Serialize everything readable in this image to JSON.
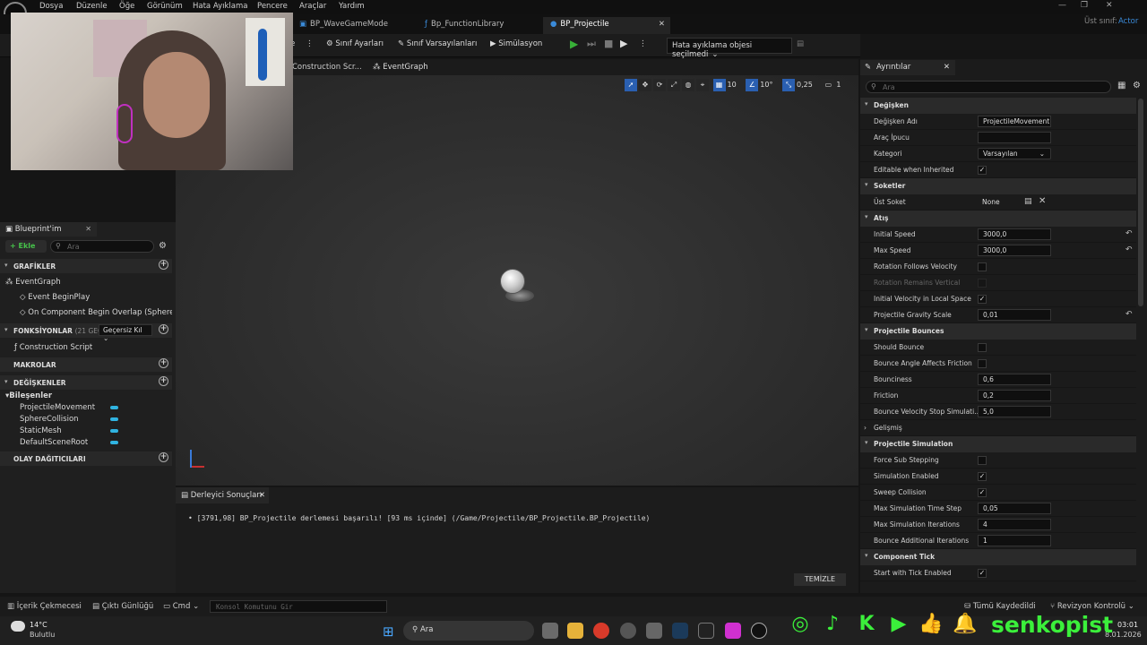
{
  "menu": [
    "Dosya",
    "Düzenle",
    "Öğe",
    "Görünüm",
    "Hata Ayıklama",
    "Pencere",
    "Araçlar",
    "Yardım"
  ],
  "tabs": [
    {
      "label": "BP_WaveGameMode"
    },
    {
      "label": "Bp_FunctionLibrary"
    },
    {
      "label": "BP_Projectile"
    }
  ],
  "window": {
    "parent_class_label": "Üst sınıf:",
    "parent_class": "Actor"
  },
  "toolbar": {
    "class_settings": "Sınıf Ayarları",
    "class_defaults": "Sınıf Varsayılanları",
    "simulation": "Simülasyon",
    "debug_object": "Hata ayıklama objesi seçilmedi"
  },
  "graph_tabs": {
    "construction": "Construction Scr...",
    "eventgraph": "EventGraph"
  },
  "viewport": {
    "grid": "10",
    "angle": "10°",
    "scale": "0,25",
    "camera": "1"
  },
  "blueprint_panel": {
    "tab": "Blueprint'im",
    "add": "Ekle",
    "search_placeholder": "Ara",
    "graphs_header": "GRAFİKLER",
    "eventgraph": "EventGraph",
    "event_beginplay": "Event BeginPlay",
    "event_overlap": "On Component Begin Overlap (SphereCol",
    "functions_header": "FONKSİYONLAR",
    "functions_count": "(21 GEÇERSİ",
    "override": "Geçersiz Kıl",
    "construction_script": "Construction Script",
    "macros_header": "MAKROLAR",
    "variables_header": "DEĞİŞKENLER",
    "components_header": "Bileşenler",
    "components": [
      "ProjectileMovement",
      "SphereCollision",
      "StaticMesh",
      "DefaultSceneRoot"
    ],
    "dispatchers_header": "OLAY DAĞITICILARI"
  },
  "compiler": {
    "tab": "Derleyici Sonuçları",
    "message": "[3791,98] BP_Projectile derlemesi başarılı! [93 ms içinde] (/Game/Projectile/BP_Projectile.BP_Projectile)",
    "clear": "TEMİZLE"
  },
  "details": {
    "tab": "Ayrıntılar",
    "search_placeholder": "Ara",
    "sec_variable": "Değişken",
    "var_name_label": "Değişken Adı",
    "var_name": "ProjectileMovement",
    "tooltip_label": "Araç İpucu",
    "tooltip": "",
    "category_label": "Kategori",
    "category": "Varsayılan",
    "editable_label": "Editable when Inherited",
    "sec_sockets": "Soketler",
    "parent_socket_label": "Üst Soket",
    "parent_socket": "None",
    "sec_shot": "Atış",
    "initial_speed_label": "Initial Speed",
    "initial_speed": "3000,0",
    "max_speed_label": "Max Speed",
    "max_speed": "3000,0",
    "rot_follows_label": "Rotation Follows Velocity",
    "rot_remains_label": "Rotation Remains Vertical",
    "init_vel_label": "Initial Velocity in Local Space",
    "gravity_label": "Projectile Gravity Scale",
    "gravity": "0,01",
    "sec_bounces": "Projectile Bounces",
    "should_bounce_label": "Should Bounce",
    "bounce_angle_label": "Bounce Angle Affects Friction",
    "bounciness_label": "Bounciness",
    "bounciness": "0,6",
    "friction_label": "Friction",
    "friction": "0,2",
    "bounce_stop_label": "Bounce Velocity Stop Simulati...",
    "bounce_stop": "5,0",
    "advanced": "Gelişmiş",
    "sec_simulation": "Projectile Simulation",
    "substep_label": "Force Sub Stepping",
    "sim_enabled_label": "Simulation Enabled",
    "sweep_label": "Sweep Collision",
    "max_step_label": "Max Simulation Time Step",
    "max_step": "0,05",
    "max_iter_label": "Max Simulation Iterations",
    "max_iter": "4",
    "bounce_iter_label": "Bounce Additional Iterations",
    "bounce_iter": "1",
    "sec_tick": "Component Tick",
    "tick_label": "Start with Tick Enabled"
  },
  "statusbar": {
    "content_drawer": "İçerik Çekmecesi",
    "output_log": "Çıktı Günlüğü",
    "cmd": "Cmd",
    "console_placeholder": "Konsol Komutunu Gir",
    "save_all": "Tümü Kaydedildi",
    "revision": "Revizyon Kontrolü"
  },
  "taskbar": {
    "weather_temp": "14°C",
    "weather_text": "Bulutlu",
    "search": "Ara",
    "time": "03:01",
    "date": "8.01.2026",
    "brand": "senkopist"
  },
  "accent_colors": {
    "blue": "#2a5fb0",
    "green": "#3bf03b",
    "variable": "#30b3e0"
  }
}
